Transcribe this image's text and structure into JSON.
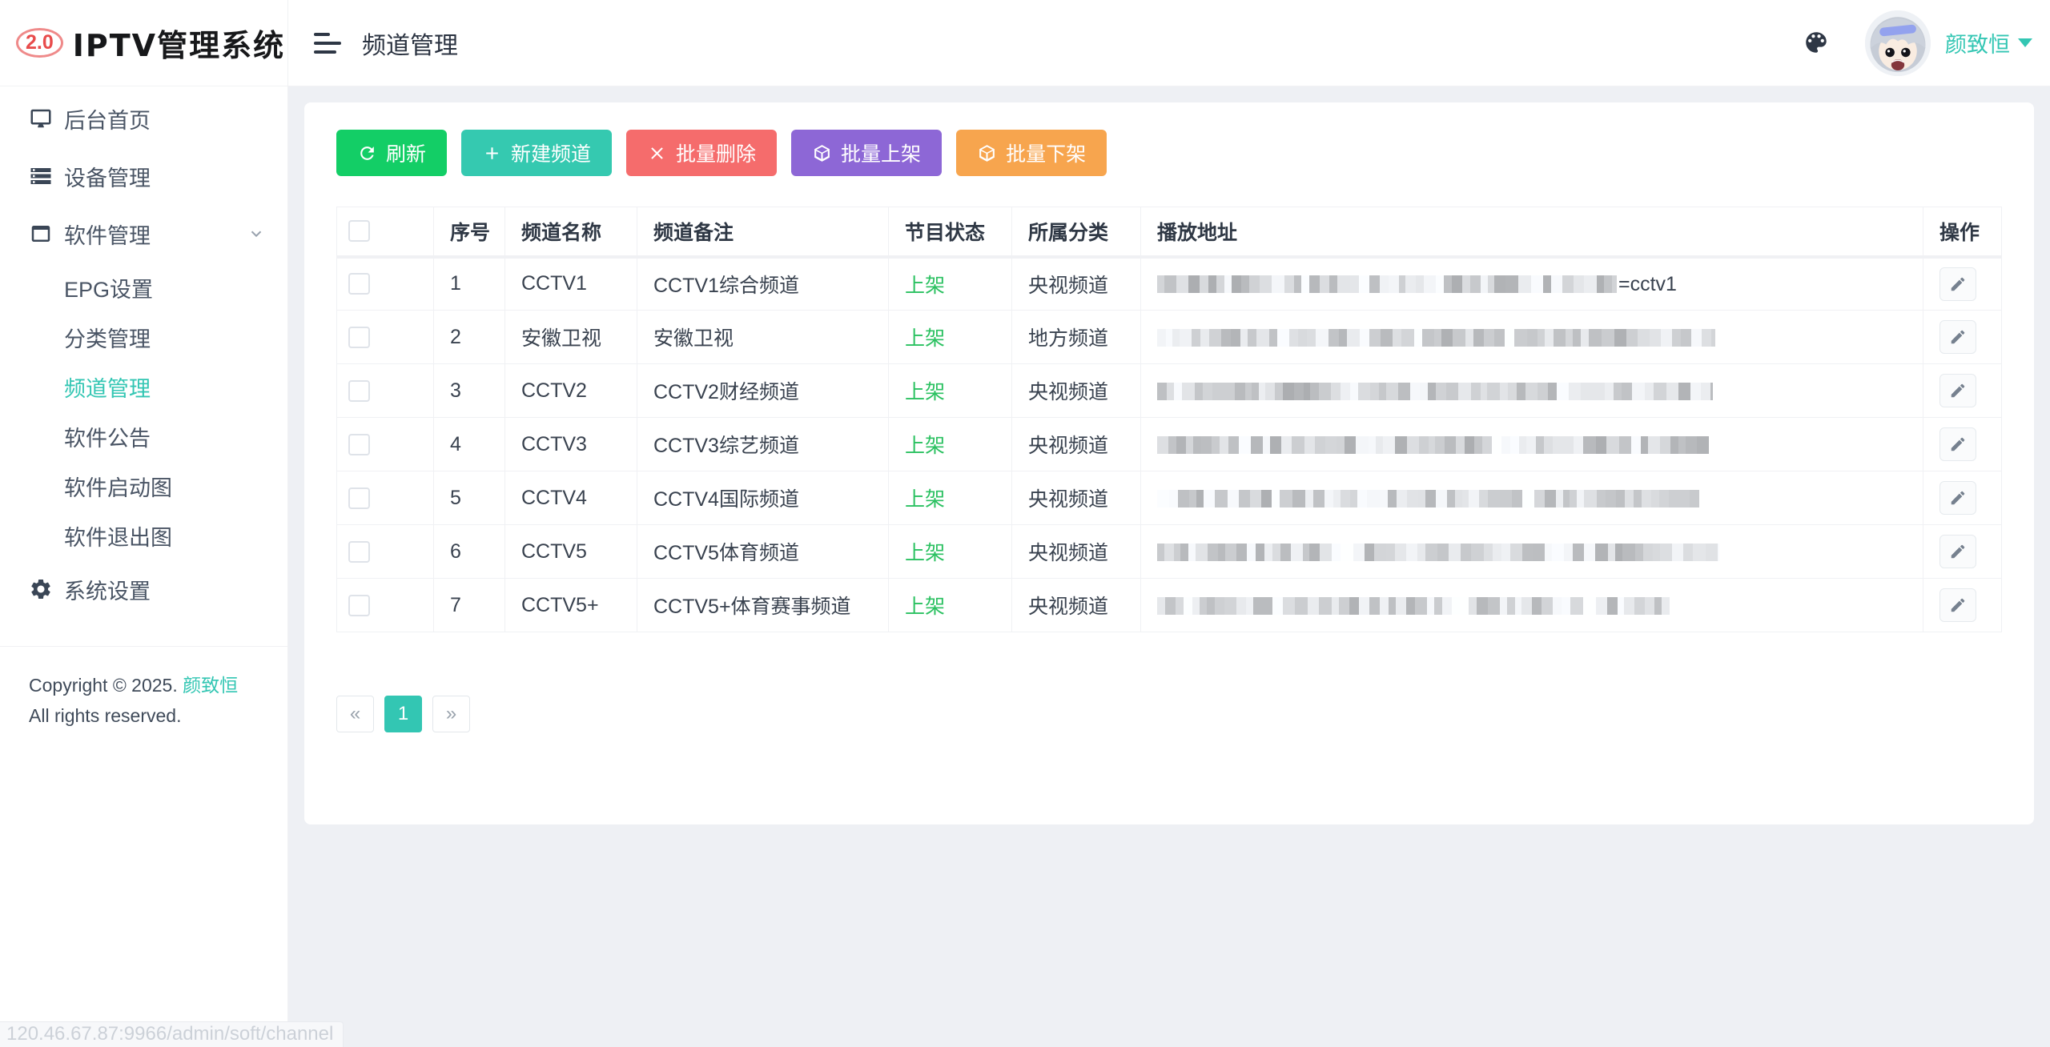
{
  "logo": {
    "badge": "2.0",
    "title": "IPTV管理系统"
  },
  "topbar": {
    "title": "频道管理",
    "username": "颜致恒"
  },
  "theme": {
    "primary": "#33c6b3",
    "status_on": "#2bc161"
  },
  "sidebar": {
    "items": [
      {
        "label": "后台首页",
        "icon": "monitor-icon"
      },
      {
        "label": "设备管理",
        "icon": "server-icon"
      },
      {
        "label": "软件管理",
        "icon": "window-icon",
        "expanded": true,
        "children": [
          {
            "label": "EPG设置"
          },
          {
            "label": "分类管理"
          },
          {
            "label": "频道管理",
            "active": true
          },
          {
            "label": "软件公告"
          },
          {
            "label": "软件启动图"
          },
          {
            "label": "软件退出图"
          }
        ]
      },
      {
        "label": "系统设置",
        "icon": "gear-icon"
      }
    ],
    "copyright": {
      "prefix": "Copyright © 2025.",
      "owner": "颜致恒",
      "suffix": "All rights reserved."
    }
  },
  "toolbar": {
    "buttons": [
      {
        "name": "refresh-button",
        "label": "刷新",
        "icon": "refresh-icon",
        "color": "#13ce66"
      },
      {
        "name": "create-channel-button",
        "label": "新建频道",
        "icon": "plus-icon",
        "color": "#35c9b0"
      },
      {
        "name": "batch-delete-button",
        "label": "批量删除",
        "icon": "close-icon",
        "color": "#f56c6c"
      },
      {
        "name": "batch-on-button",
        "label": "批量上架",
        "icon": "box-icon",
        "color": "#8d67d6"
      },
      {
        "name": "batch-off-button",
        "label": "批量下架",
        "icon": "box-icon",
        "color": "#f7a54e"
      }
    ]
  },
  "table": {
    "headers": [
      "序号",
      "频道名称",
      "频道备注",
      "节目状态",
      "所属分类",
      "播放地址",
      "操作"
    ],
    "rows": [
      {
        "index": "1",
        "name": "CCTV1",
        "note": "CCTV1综合频道",
        "status": "上架",
        "category": "央视频道",
        "url_visible": "=cctv1",
        "mask_width": 574
      },
      {
        "index": "2",
        "name": "安徽卫视",
        "note": "安徽卫视",
        "status": "上架",
        "category": "地方频道",
        "url_visible": "",
        "mask_width": 697
      },
      {
        "index": "3",
        "name": "CCTV2",
        "note": "CCTV2财经频道",
        "status": "上架",
        "category": "央视频道",
        "url_visible": "",
        "mask_width": 694
      },
      {
        "index": "4",
        "name": "CCTV3",
        "note": "CCTV3综艺频道",
        "status": "上架",
        "category": "央视频道",
        "url_visible": "",
        "mask_width": 689
      },
      {
        "index": "5",
        "name": "CCTV4",
        "note": "CCTV4国际频道",
        "status": "上架",
        "category": "央视频道",
        "url_visible": "",
        "mask_width": 677
      },
      {
        "index": "6",
        "name": "CCTV5",
        "note": "CCTV5体育频道",
        "status": "上架",
        "category": "央视频道",
        "url_visible": "",
        "mask_width": 702
      },
      {
        "index": "7",
        "name": "CCTV5+",
        "note": "CCTV5+体育赛事频道",
        "status": "上架",
        "category": "央视频道",
        "url_visible": "",
        "mask_width": 640
      }
    ]
  },
  "pagination": {
    "prev": "«",
    "current": "1",
    "next": "»"
  },
  "statusbar": {
    "url": "120.46.67.87:9966/admin/soft/channel"
  }
}
